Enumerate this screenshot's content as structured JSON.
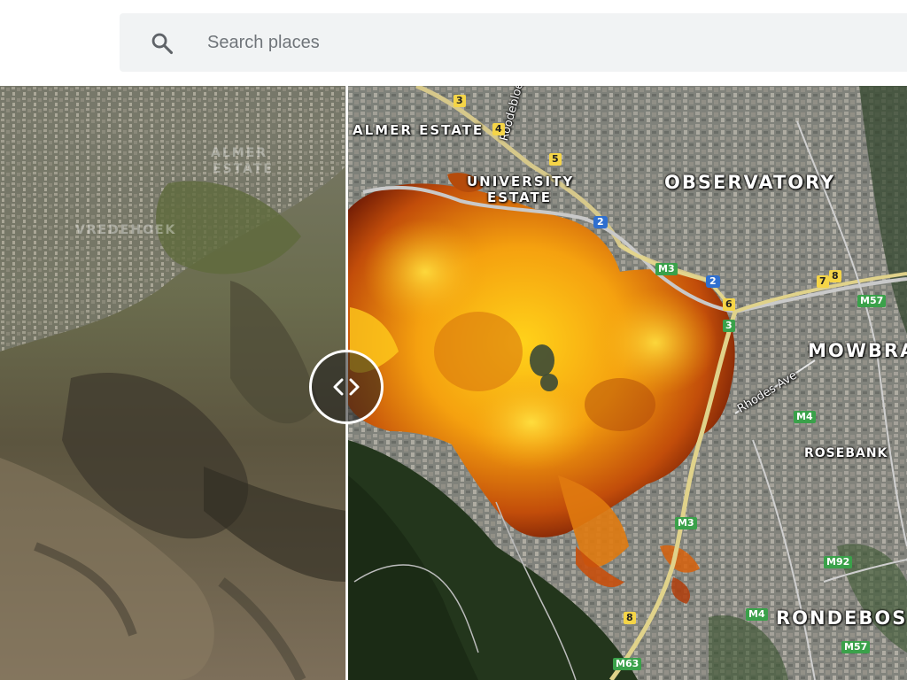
{
  "search": {
    "placeholder": "Search places",
    "icon": "search-icon"
  },
  "map": {
    "left_layer": "satellite (before)",
    "right_layer": "satellite with fire heat overlay (after)",
    "slider_icon": "compare-arrows-icon",
    "labels": {
      "observatory": "OBSERVATORY",
      "mowbray": "MOWBRA",
      "rosebank": "ROSEBANK",
      "rondebosch": "RONDEBOS",
      "university_estate_1": "UNIVERSITY",
      "university_estate_2": "ESTATE",
      "walmer_estate": "ALMER ESTATE",
      "rhodes_ave": "Rhodes Ave",
      "roodebloem": "Roodebloem",
      "faint_walmer": "ALMER",
      "faint_estate": "ESTATE",
      "faint_oranjezicht": "VREDEHOEK"
    },
    "shields": {
      "r3a": "3",
      "r4": "4",
      "r5": "5",
      "r2a": "2",
      "m3a": "M3",
      "r2b": "2",
      "r7": "7",
      "r8": "8",
      "r6": "6",
      "r3b": "3",
      "m57a": "M57",
      "m4": "M4",
      "m3b": "M3",
      "m92": "M92",
      "r8b": "8",
      "m4b": "M4",
      "m63": "M63",
      "m57b": "M57"
    }
  }
}
